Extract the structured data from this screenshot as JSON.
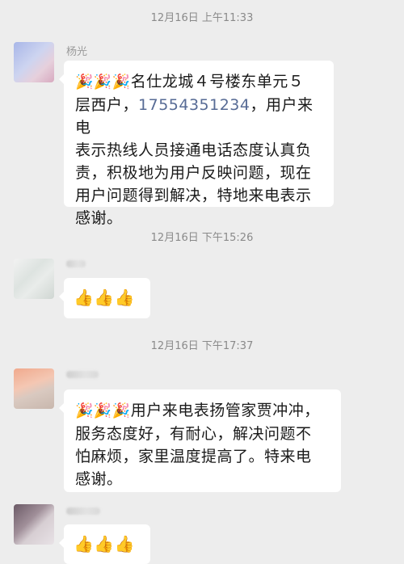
{
  "timestamps": [
    "12月16日 上午11:33",
    "12月16日 下午15:26",
    "12月16日 下午17:37"
  ],
  "messages": [
    {
      "sender": "杨光",
      "emoji": "🎉🎉🎉",
      "text_lines": [
        "名仕龙城４号楼东单元５",
        "层西户，",
        "表示热线人员接通电话态度认真负",
        "责，积极地为用户反映问题，现在",
        "用户问题得到解决，特地来电表示",
        "感谢。"
      ],
      "phone": "17554351234",
      "after_phone": "，用户来电"
    },
    {
      "emoji": "👍👍👍"
    },
    {
      "emoji": "🎉🎉🎉",
      "text_lines": [
        "用户来电表扬管家贾冲冲，",
        "服务态度好，有耐心，解决问题不",
        "怕麻烦，家里温度提高了。特来电",
        "感谢。"
      ]
    },
    {
      "emoji": "👍👍👍"
    }
  ]
}
